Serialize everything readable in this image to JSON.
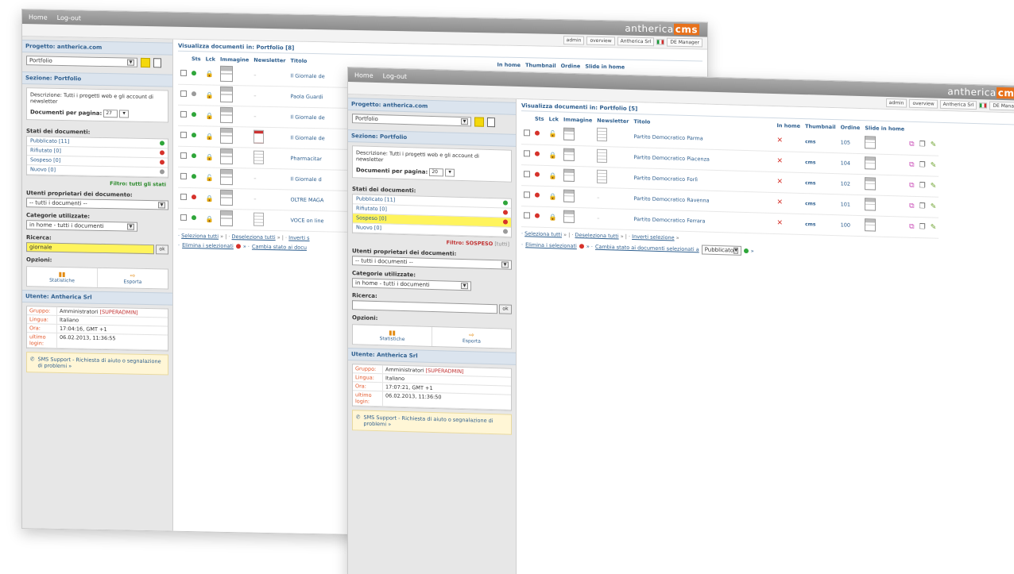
{
  "back": {
    "nav": [
      "Home",
      "Log-out"
    ],
    "logo_main": "antherica",
    "logo_cms": "cms",
    "userbar": [
      "admin",
      "overview",
      "Antherica Srl",
      "DE Manager"
    ],
    "project_head": "Progetto: antherica.com",
    "section_select": "Portfolio",
    "section_head": "Sezione: Portfolio",
    "description": "Descrizione: Tutti i progetti web e gli account di newsletter",
    "docs_per_page_label": "Documenti per pagina:",
    "docs_per_page_value": "27",
    "states_label": "Stati dei documenti:",
    "states": [
      {
        "label": "Pubblicato",
        "count": "[11]",
        "color": "green"
      },
      {
        "label": "Rifiutato",
        "count": "[0]",
        "color": "red"
      },
      {
        "label": "Sospeso",
        "count": "[0]",
        "color": "red"
      },
      {
        "label": "Nuovo",
        "count": "[0]",
        "color": "grey"
      }
    ],
    "filter_label": "Filtro:",
    "filter_value": "tutti gli stati",
    "owners_label": "Utenti proprietari dei documento:",
    "owners_select": "-- tutti i documenti --",
    "categories_label": "Categorie utilizzate:",
    "categories_select": "in home - tutti i documenti",
    "search_label": "Ricerca:",
    "search_value": "giornale",
    "search_go": "ok",
    "options_label": "Opzioni:",
    "option_stats": "Statistiche",
    "option_export": "Esporta",
    "user_head": "Utente: Antherica Srl",
    "user_rows": [
      {
        "k": "Gruppo:",
        "v": "Amministratori",
        "role": "[SUPERADMIN]"
      },
      {
        "k": "Lingua:",
        "v": "Italiano",
        "role": ""
      },
      {
        "k": "Ora:",
        "v": "17:04:16, GMT +1",
        "role": ""
      },
      {
        "k": "ultimo login:",
        "v": "06.02.2013, 11:36:55",
        "role": ""
      }
    ],
    "support": "SMS Support - Richiesta di aiuto o segnalazione di problemi »",
    "main_title": "Visualizza documenti in: Portfolio [8]",
    "columns": [
      "Sts",
      "Lck",
      "Immagine",
      "Newsletter",
      "Titolo"
    ],
    "extra_columns": [
      "In home",
      "Thumbnail",
      "Ordine",
      "Slide in home"
    ],
    "rows": [
      {
        "sts": "green",
        "lck": "closed",
        "nl": "none",
        "title": "Il Giornale de"
      },
      {
        "sts": "grey",
        "lck": "closed",
        "nl": "none",
        "title": "Paola Guardi"
      },
      {
        "sts": "green",
        "lck": "closed",
        "nl": "none",
        "title": "Il Giornale de"
      },
      {
        "sts": "green",
        "lck": "closed",
        "nl": "red",
        "title": "Il Giornale de"
      },
      {
        "sts": "green",
        "lck": "closed",
        "nl": "lines",
        "title": "Pharmacitar"
      },
      {
        "sts": "green",
        "lck": "open",
        "nl": "none",
        "title": "Il Giornale d"
      },
      {
        "sts": "red",
        "lck": "closed",
        "nl": "none",
        "title": "OLTRE MAGA"
      },
      {
        "sts": "green",
        "lck": "closed",
        "nl": "lines",
        "title": "VOCE on line"
      }
    ],
    "links_line": [
      "Seleziona tutti",
      "Deseleziona tutti",
      "Inverti s"
    ],
    "delete_label": "Elimina i selezionati",
    "change_state": "Cambia stato ai docu"
  },
  "front": {
    "nav": [
      "Home",
      "Log-out"
    ],
    "logo_main": "antherica",
    "logo_cms": "cms",
    "userbar": [
      "admin",
      "overview",
      "Antherica Srl",
      "DE Manager"
    ],
    "project_head": "Progetto: antherica.com",
    "section_select": "Portfolio",
    "section_head": "Sezione: Portfolio",
    "description": "Descrizione: Tutti i progetti web e gli account di newsletter",
    "docs_per_page_label": "Documenti per pagina:",
    "docs_per_page_value": "20",
    "states_label": "Stati dei documenti:",
    "states": [
      {
        "label": "Pubblicato",
        "count": "[11]",
        "color": "green",
        "hl": false
      },
      {
        "label": "Rifiutato",
        "count": "[0]",
        "color": "red",
        "hl": false
      },
      {
        "label": "Sospeso",
        "count": "[0]",
        "color": "red",
        "hl": true
      },
      {
        "label": "Nuovo",
        "count": "[0]",
        "color": "grey",
        "hl": false
      }
    ],
    "filter_label": "Filtro:",
    "filter_value": "SOSPESO",
    "filter_all": "[tutti]",
    "owners_label": "Utenti proprietari dei documenti:",
    "owners_select": "-- tutti i documenti --",
    "categories_label": "Categorie utilizzate:",
    "categories_select": "in home - tutti i documenti",
    "search_label": "Ricerca:",
    "search_value": "",
    "search_go": "ok",
    "options_label": "Opzioni:",
    "option_stats": "Statistiche",
    "option_export": "Esporta",
    "user_head": "Utente: Antherica Srl",
    "user_rows": [
      {
        "k": "Gruppo:",
        "v": "Amministratori",
        "role": "[SUPERADMIN]"
      },
      {
        "k": "Lingua:",
        "v": "Italiano",
        "role": ""
      },
      {
        "k": "Ora:",
        "v": "17:07:21, GMT +1",
        "role": ""
      },
      {
        "k": "ultimo login:",
        "v": "06.02.2013, 11:36:50",
        "role": ""
      }
    ],
    "support": "SMS Support - Richiesta di aiuto o segnalazione di problemi »",
    "main_title": "Visualizza documenti in: Portfolio [5]",
    "columns": [
      "Sts",
      "Lck",
      "Immagine",
      "Newsletter",
      "Titolo",
      "In home",
      "Thumbnail",
      "Ordine",
      "Slide in home"
    ],
    "rows": [
      {
        "lck": "open",
        "nl": "lines",
        "title": "Partito Democratico Parma",
        "order": "105"
      },
      {
        "lck": "closed",
        "nl": "lines",
        "title": "Partito Democratico Piacenza",
        "order": "104"
      },
      {
        "lck": "closed",
        "nl": "lines",
        "title": "Partito Democratico Forlì",
        "order": "102"
      },
      {
        "lck": "closed",
        "nl": "none",
        "title": "Partito Democratico Ravenna",
        "order": "101"
      },
      {
        "lck": "closed",
        "nl": "none",
        "title": "Partito Democratico Ferrara",
        "order": "100"
      }
    ],
    "thumb_label": "cms",
    "links_line": [
      "Seleziona tutti",
      "Deseleziona tutti",
      "Inverti selezione"
    ],
    "delete_label": "Elimina i selezionati",
    "change_state": "Cambia stato ai documenti selezionati a",
    "change_state_select": "Pubblicato"
  }
}
